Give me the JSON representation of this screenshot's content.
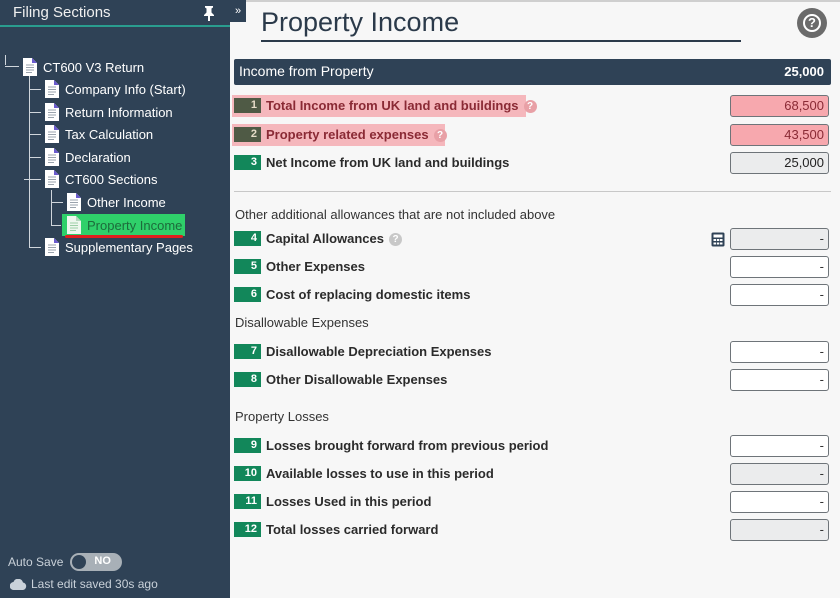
{
  "sidebar": {
    "title": "Filing Sections",
    "tree": [
      {
        "label": "CT600 V3 Return"
      },
      {
        "label": "Company Info (Start)"
      },
      {
        "label": "Return Information"
      },
      {
        "label": "Tax Calculation"
      },
      {
        "label": "Declaration"
      },
      {
        "label": "CT600 Sections"
      },
      {
        "label": "Other Income"
      },
      {
        "label": "Property Income",
        "selected": true
      },
      {
        "label": "Supplementary Pages"
      }
    ],
    "autosave_label": "Auto Save",
    "autosave_state": "NO",
    "last_saved": "Last edit saved 30s ago"
  },
  "collapse_glyph": "»",
  "page": {
    "title": "Property Income",
    "help_glyph": "?"
  },
  "section": {
    "title": "Income from Property",
    "total": "25,000"
  },
  "rows": [
    {
      "num": "1",
      "label": "Total Income from UK land and buildings",
      "value": "68,500",
      "state": "error",
      "help": true
    },
    {
      "num": "2",
      "label": "Property related expenses",
      "value": "43,500",
      "state": "error",
      "help": true
    },
    {
      "num": "3",
      "label": "Net Income from UK land and buildings",
      "value": "25,000",
      "state": "readonly"
    },
    {
      "num": "4",
      "label": "Capital Allowances",
      "value": "-",
      "state": "readonly",
      "help": true,
      "calculator": true
    },
    {
      "num": "5",
      "label": "Other Expenses",
      "value": "-",
      "state": "editable"
    },
    {
      "num": "6",
      "label": "Cost of replacing domestic items",
      "value": "-",
      "state": "editable"
    },
    {
      "num": "7",
      "label": "Disallowable Depreciation Expenses",
      "value": "-",
      "state": "editable"
    },
    {
      "num": "8",
      "label": "Other Disallowable Expenses",
      "value": "-",
      "state": "editable"
    },
    {
      "num": "9",
      "label": "Losses brought forward from previous period",
      "value": "-",
      "state": "editable"
    },
    {
      "num": "10",
      "label": "Available losses to use in this period",
      "value": "-",
      "state": "readonly"
    },
    {
      "num": "11",
      "label": "Losses Used in this period",
      "value": "-",
      "state": "editable"
    },
    {
      "num": "12",
      "label": "Total losses carried forward",
      "value": "-",
      "state": "readonly"
    }
  ],
  "subheadings": {
    "allowances": "Other additional allowances that are not included above",
    "disallowable": "Disallowable Expenses",
    "losses": "Property Losses"
  },
  "colors": {
    "sidebar_bg": "#2f4256",
    "accent_teal": "#2a9d8f",
    "badge_green": "#12875a",
    "error_bg": "#f5b7bc",
    "selected_green": "#2fd06a"
  }
}
